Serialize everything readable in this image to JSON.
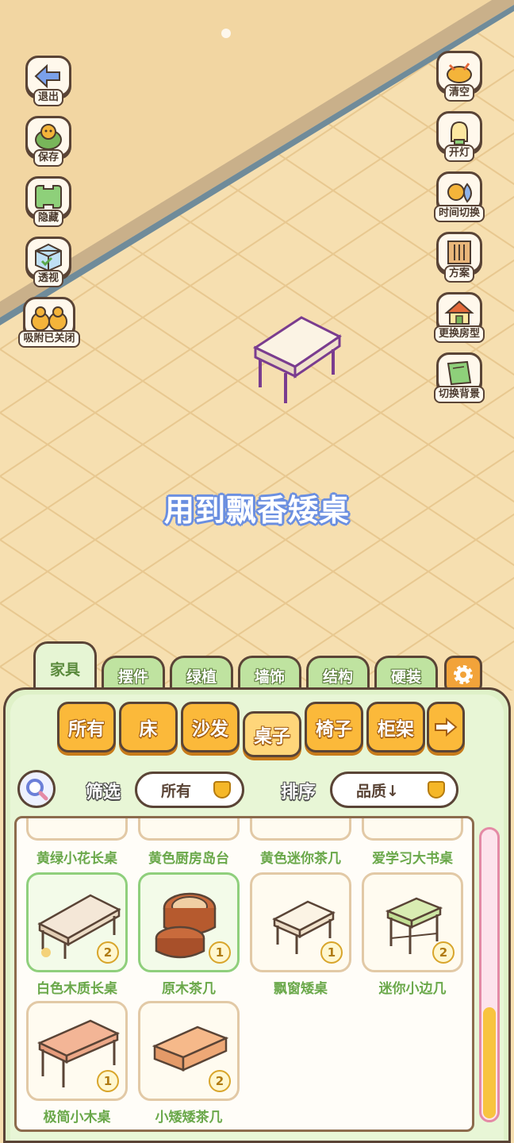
{
  "side_left": [
    {
      "label": "退出",
      "icon": "exit-arrow-icon"
    },
    {
      "label": "保存",
      "icon": "duck-save-icon"
    },
    {
      "label": "隐藏",
      "icon": "hide-icon"
    },
    {
      "label": "透视",
      "icon": "cube-view-icon"
    },
    {
      "label": "吸附已关闭",
      "icon": "duck-snap-icon"
    }
  ],
  "side_right": [
    {
      "label": "清空",
      "icon": "clear-icon"
    },
    {
      "label": "开灯",
      "icon": "light-icon"
    },
    {
      "label": "时间切换",
      "icon": "sun-moon-icon"
    },
    {
      "label": "方案",
      "icon": "scheme-icon"
    },
    {
      "label": "更换房型",
      "icon": "house-icon"
    },
    {
      "label": "切换背景",
      "icon": "background-icon"
    }
  ],
  "center_message": "用到飘香矮桌",
  "category_tabs": [
    "家具",
    "摆件",
    "绿植",
    "墙饰",
    "结构",
    "硬装"
  ],
  "active_category": "家具",
  "sub_tabs": [
    "所有",
    "床",
    "沙发",
    "桌子",
    "椅子",
    "柜架"
  ],
  "active_sub_tab": "桌子",
  "filter": {
    "label": "筛选",
    "value": "所有"
  },
  "sort": {
    "label": "排序",
    "value": "品质↓"
  },
  "prev_row_items": [
    "黄绿小花长桌",
    "黄色厨房岛台",
    "黄色迷你茶几",
    "爱学习大书桌"
  ],
  "items": [
    {
      "name": "白色木质长桌",
      "qty": "2",
      "icon": "white-long-table-icon",
      "color": "#f4e7d7"
    },
    {
      "name": "原木茶几",
      "qty": "1",
      "icon": "round-wood-table-icon",
      "color": "#c96b3c"
    },
    {
      "name": "飘窗矮桌",
      "qty": "1",
      "icon": "bay-window-table-icon",
      "color": "#fbf3e4"
    },
    {
      "name": "迷你小边几",
      "qty": "2",
      "icon": "mini-side-table-icon",
      "color": "#d9ecb2"
    },
    {
      "name": "极简小木桌",
      "qty": "1",
      "icon": "simple-wood-table-icon",
      "color": "#f3b596"
    },
    {
      "name": "小矮矮茶几",
      "qty": "2",
      "icon": "low-tea-table-icon",
      "color": "#f6b98a"
    }
  ],
  "colors": {
    "panel_green": "#dff1c8",
    "tab_orange": "#fbb93a",
    "item_name_green": "#6aa84a",
    "outline_brown": "#5a4436",
    "message_blue": "#6b8fe0",
    "selected_outline": "#7a3c8f"
  }
}
